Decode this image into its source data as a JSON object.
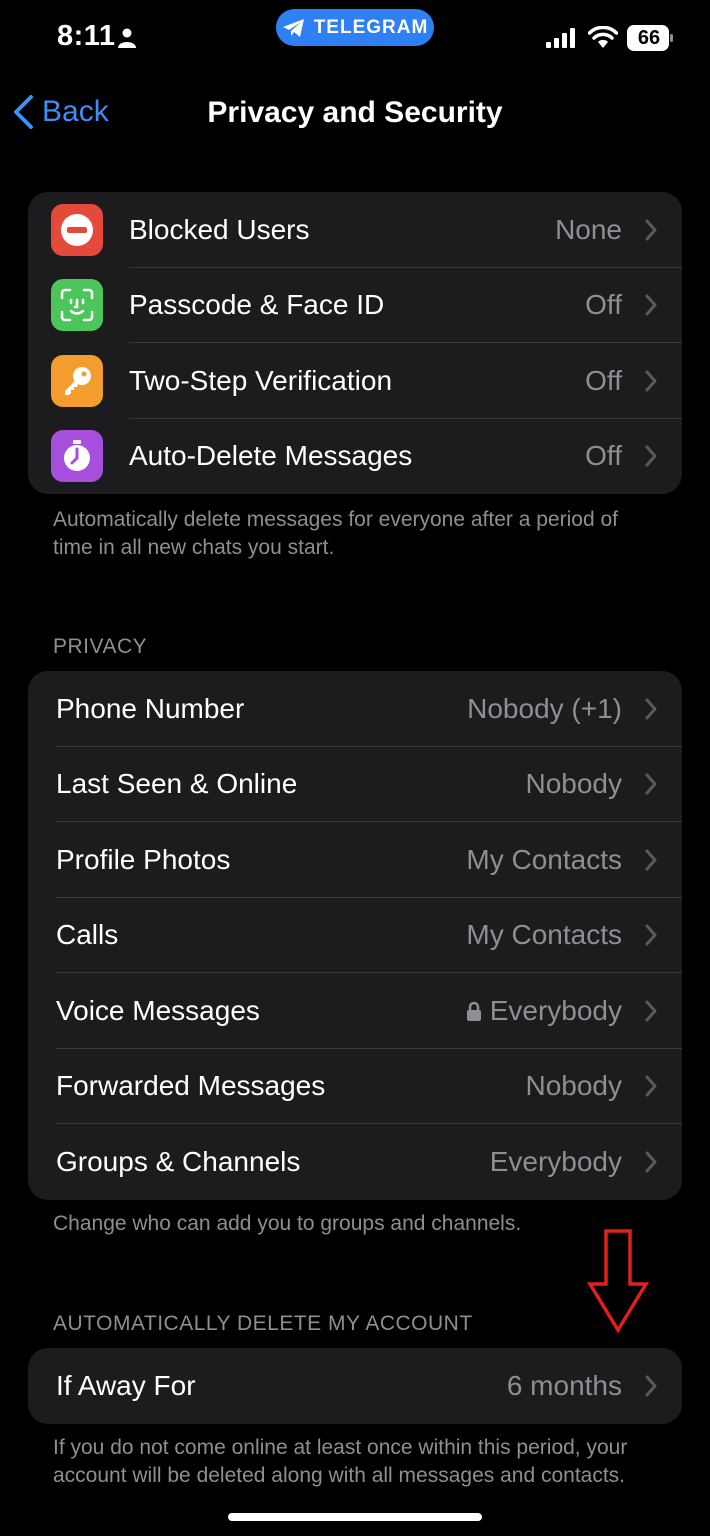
{
  "status_bar": {
    "time": "8:11",
    "app_pill": "TELEGRAM",
    "battery": "66"
  },
  "nav": {
    "back_label": "Back",
    "title": "Privacy and Security"
  },
  "security": {
    "items": [
      {
        "label": "Blocked Users",
        "value": "None",
        "icon": "blocked-icon",
        "color": "#e5493a"
      },
      {
        "label": "Passcode & Face ID",
        "value": "Off",
        "icon": "face-id-icon",
        "color": "#4cc65a"
      },
      {
        "label": "Two-Step Verification",
        "value": "Off",
        "icon": "key-icon",
        "color": "#f39d2f"
      },
      {
        "label": "Auto-Delete Messages",
        "value": "Off",
        "icon": "timer-icon",
        "color": "#a54fdc"
      }
    ],
    "footnote": "Automatically delete messages for everyone after a period of time in all new chats you start."
  },
  "privacy": {
    "header": "PRIVACY",
    "items": [
      {
        "label": "Phone Number",
        "value": "Nobody (+1)"
      },
      {
        "label": "Last Seen & Online",
        "value": "Nobody"
      },
      {
        "label": "Profile Photos",
        "value": "My Contacts"
      },
      {
        "label": "Calls",
        "value": "My Contacts"
      },
      {
        "label": "Voice Messages",
        "value": "Everybody",
        "locked": true
      },
      {
        "label": "Forwarded Messages",
        "value": "Nobody"
      },
      {
        "label": "Groups & Channels",
        "value": "Everybody"
      }
    ],
    "footnote": "Change who can add you to groups and channels."
  },
  "account_deletion": {
    "header": "AUTOMATICALLY DELETE MY ACCOUNT",
    "item": {
      "label": "If Away For",
      "value": "6 months"
    },
    "footnote": "If you do not come online at least once within this period, your account will be deleted along with all messages and contacts."
  },
  "colors": {
    "accent": "#3d8ff6",
    "annotation_arrow": "#e0201c"
  }
}
